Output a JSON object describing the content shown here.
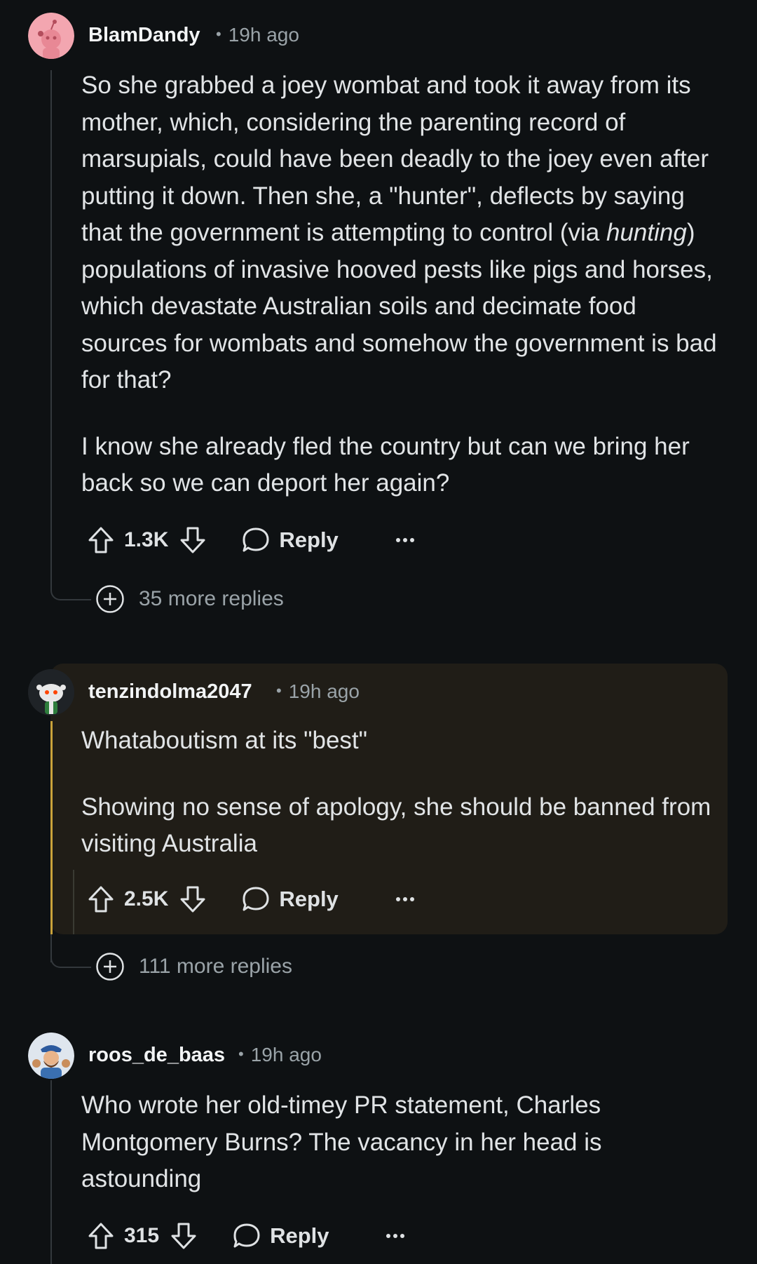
{
  "colors": {
    "background": "#0e1113",
    "highlight": "#201d17",
    "accent_bar": "#c9a23a",
    "text": "#e1e4e6",
    "muted": "#9aa3a8"
  },
  "comments": [
    {
      "author": "BlamDandy",
      "age": "19h ago",
      "avatar_icon": "snoo-avatar-pink",
      "paragraphs": [
        "So she grabbed a joey wombat and took it away from its mother, which, considering the parenting record of marsupials, could have been deadly to the joey even after putting it down. Then she, a \"hunter\", deflects by saying that the government is attempting to control (via ",
        "hunting",
        ") populations of invasive hooved pests like pigs and horses, which devastate Australian soils and decimate food sources for wombats and somehow the government is bad for that?",
        "I know she already fled the country but can we bring her back so we can deport her again?"
      ],
      "score": "1.3K",
      "reply_label": "Reply",
      "more_replies": "35 more replies"
    },
    {
      "author": "tenzindolma2047",
      "age": "19h ago",
      "avatar_icon": "snoo-avatar-dark",
      "paragraphs": [
        "Whataboutism at its \"best\"",
        "Showing no sense of apology, she should be banned from visiting Australia"
      ],
      "score": "2.5K",
      "reply_label": "Reply",
      "more_replies": "111 more replies"
    },
    {
      "author": "roos_de_baas",
      "age": "19h ago",
      "avatar_icon": "cartoon-avatar",
      "paragraphs": [
        "Who wrote her old-timey PR statement, Charles Montgomery Burns? The vacancy in her head is astounding"
      ],
      "score": "315",
      "reply_label": "Reply"
    }
  ]
}
